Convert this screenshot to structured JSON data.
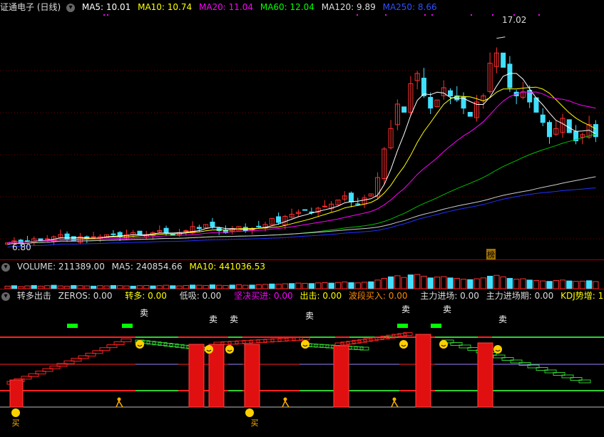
{
  "main_header": {
    "title": "证通电子 (日线)",
    "ma": [
      {
        "label": "MA5: 10.01",
        "color": "#ffffff"
      },
      {
        "label": "MA10: 10.74",
        "color": "#ffff00"
      },
      {
        "label": "MA20: 11.04",
        "color": "#ff00ff"
      },
      {
        "label": "MA60: 12.04",
        "color": "#00ff00"
      },
      {
        "label": "MA120: 9.89",
        "color": "#dddddd"
      },
      {
        "label": "MA250: 8.66",
        "color": "#3050ff"
      }
    ]
  },
  "price_chart": {
    "high_label": "17.02",
    "low_label": "6.80",
    "badge": "榜",
    "chart_data": {
      "type": "candlestick",
      "ylim": [
        6.5,
        17.5
      ],
      "high": 17.02,
      "low": 6.8,
      "close_trend": [
        7.0,
        7.1,
        7.0,
        7.1,
        7.2,
        7.1,
        7.2,
        7.3,
        7.4,
        7.2,
        7.1,
        7.3,
        7.2,
        7.3,
        7.3,
        7.4,
        7.4,
        7.3,
        7.4,
        7.5,
        7.4,
        7.4,
        7.5,
        7.6,
        7.5,
        7.4,
        7.5,
        7.6,
        7.8,
        7.7,
        7.9,
        7.8,
        7.6,
        7.5,
        7.7,
        7.8,
        7.6,
        7.7,
        7.8,
        7.9,
        8.2,
        8.0,
        8.3,
        8.4,
        8.5,
        8.6,
        8.5,
        8.7,
        8.8,
        8.9,
        9.1,
        9.3,
        9.0,
        8.9,
        9.2,
        9.4,
        10.2,
        11.6,
        12.6,
        13.8,
        13.4,
        14.8,
        15.3,
        14.2,
        13.6,
        14.0,
        14.6,
        14.2,
        14.0,
        13.6,
        13.2,
        13.9,
        14.2,
        15.8,
        16.3,
        15.6,
        14.6,
        14.2,
        14.4,
        13.9,
        13.4,
        12.9,
        12.2,
        12.6,
        13.1,
        12.4,
        12.0,
        12.3,
        12.8,
        12.2
      ]
    }
  },
  "volume_header": {
    "title": "VOLUME: 211389.00",
    "ma5": "MA5: 240854.66",
    "ma10": "MA10: 441036.53"
  },
  "volume_data": [
    12,
    14,
    10,
    13,
    15,
    12,
    14,
    16,
    13,
    12,
    15,
    14,
    13,
    12,
    14,
    13,
    15,
    14,
    13,
    12,
    14,
    15,
    13,
    14,
    16,
    14,
    13,
    15,
    17,
    16,
    15,
    18,
    16,
    15,
    17,
    18,
    16,
    17,
    19,
    20,
    22,
    21,
    23,
    24,
    26,
    25,
    24,
    27,
    28,
    26,
    29,
    31,
    28,
    27,
    30,
    32,
    40,
    48,
    55,
    60,
    52,
    64,
    66,
    58,
    50,
    54,
    56,
    50,
    48,
    44,
    42,
    46,
    50,
    58,
    62,
    55,
    48,
    44,
    46,
    40,
    38,
    36,
    34,
    38,
    40,
    36,
    34,
    35,
    37,
    33
  ],
  "indicator_header": {
    "title": "转多出击",
    "items": [
      {
        "label": "ZEROS: 0.00",
        "color": "#dddddd"
      },
      {
        "label": "转多: 0.00",
        "color": "#ffff00"
      },
      {
        "label": "低吸: 0.00",
        "color": "#dddddd"
      },
      {
        "label": "坚决买进: 0.00",
        "color": "#ff00ff"
      },
      {
        "label": "出击: 0.00",
        "color": "#ffff00"
      },
      {
        "label": "波段买入: 0.00",
        "color": "#ff8800"
      },
      {
        "label": "主力进场: 0.00",
        "color": "#dddddd"
      },
      {
        "label": "主力进场期: 0.00",
        "color": "#dddddd"
      },
      {
        "label": "KDJ势增: 1",
        "color": "#ffff00"
      }
    ]
  },
  "signals": {
    "sell": "卖",
    "buy": "买"
  }
}
